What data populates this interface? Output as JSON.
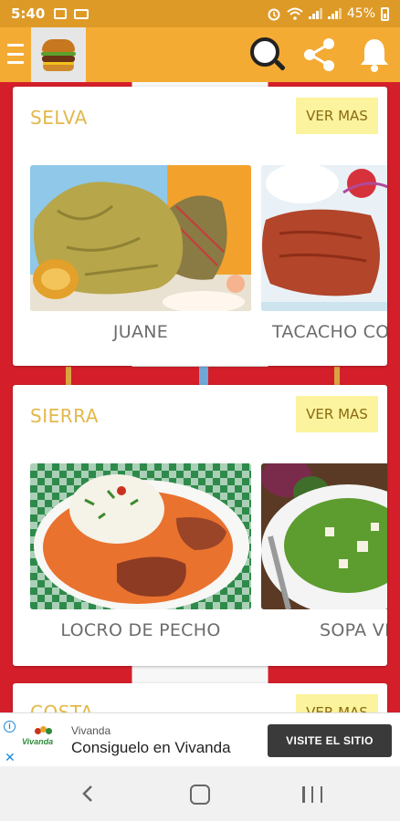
{
  "status_bar": {
    "time": "5:40",
    "battery": "45%",
    "battery_level": 0.45
  },
  "toolbar": {
    "menu_icon": "hamburger-menu-icon",
    "logo_icon": "burger-logo-icon",
    "search_icon": "search-magnifier-icon",
    "share_icon": "share-icon",
    "bell_icon": "notification-bell-icon"
  },
  "categories": [
    {
      "title": "SELVA",
      "ver_mas": "VER MAS",
      "dishes": [
        {
          "name": "JUANE"
        },
        {
          "name": "TACACHO CO"
        }
      ]
    },
    {
      "title": "SIERRA",
      "ver_mas": "VER MAS",
      "dishes": [
        {
          "name": "LOCRO DE PECHO"
        },
        {
          "name": "SOPA VE"
        }
      ]
    },
    {
      "title": "COSTA",
      "ver_mas": "VER MAS"
    }
  ],
  "ad": {
    "brand": "Vivanda",
    "logo_text": "Vivanda",
    "headline": "Consiguelo en Vivanda",
    "cta": "VISITE EL SITIO"
  },
  "colors": {
    "status_bar": "#de9a27",
    "toolbar": "#f4ab34",
    "category_title": "#e3b84a",
    "ver_mas_bg": "#fbf39d",
    "flag_red": "#d41f2a",
    "ad_cta": "#3a3a3a"
  }
}
